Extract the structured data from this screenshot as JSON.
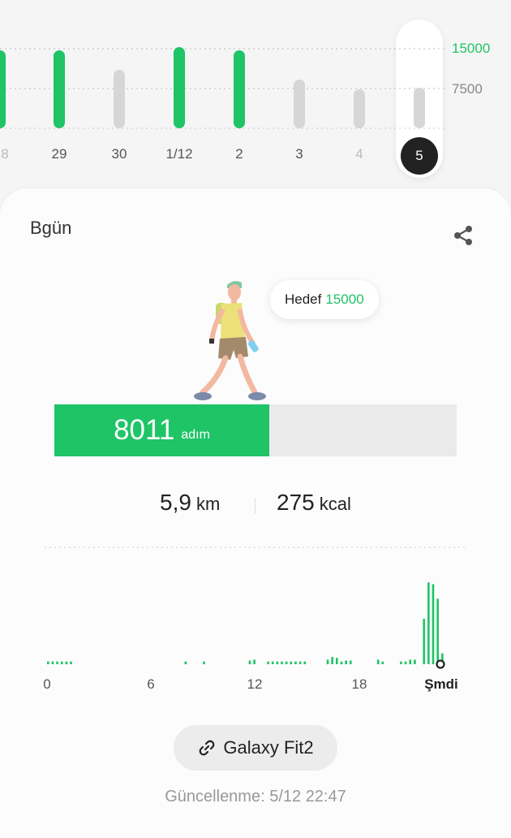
{
  "weekly_chart": {
    "reference_lines": [
      {
        "value": 15000,
        "label": "15000",
        "color": "#1fc466"
      },
      {
        "value": 7500,
        "label": "7500",
        "color": "#888888"
      }
    ],
    "days": [
      {
        "label": "8",
        "fraction": 0.96,
        "goal_met": true,
        "dim": true
      },
      {
        "label": "29",
        "fraction": 0.96,
        "goal_met": true,
        "dim": false
      },
      {
        "label": "30",
        "fraction": 0.72,
        "goal_met": false,
        "dim": false
      },
      {
        "label": "1/12",
        "fraction": 1.0,
        "goal_met": true,
        "dim": false
      },
      {
        "label": "2",
        "fraction": 0.96,
        "goal_met": true,
        "dim": false
      },
      {
        "label": "3",
        "fraction": 0.6,
        "goal_met": false,
        "dim": false
      },
      {
        "label": "4",
        "fraction": 0.48,
        "goal_met": false,
        "dim": true
      },
      {
        "label": "5",
        "fraction": 0.5,
        "goal_met": false,
        "dim": false,
        "selected": true
      }
    ]
  },
  "today": {
    "title": "Bgün",
    "share_icon": "share-icon",
    "goal_prefix": "Hedef",
    "goal_value": "15000",
    "steps_value": "8011",
    "steps_unit": "adım",
    "steps_progress": 0.534,
    "distance_value": "5,9",
    "distance_unit": "km",
    "calories_value": "275",
    "calories_unit": "kcal"
  },
  "hourly_chart": {
    "x_labels": [
      "0",
      "6",
      "12",
      "18",
      "Şmdi"
    ],
    "values": [
      0.03,
      0.03,
      0.03,
      0.03,
      0.03,
      0.03,
      0,
      0,
      0,
      0,
      0,
      0,
      0,
      0,
      0,
      0,
      0,
      0,
      0,
      0,
      0,
      0,
      0,
      0,
      0,
      0,
      0,
      0,
      0,
      0,
      0.03,
      0,
      0,
      0,
      0.03,
      0,
      0,
      0,
      0,
      0,
      0,
      0,
      0,
      0,
      0.04,
      0.05,
      0,
      0,
      0.03,
      0.03,
      0.03,
      0.03,
      0.03,
      0.03,
      0.03,
      0.03,
      0.03,
      0,
      0,
      0,
      0,
      0.05,
      0.08,
      0.07,
      0.03,
      0.04,
      0.04,
      0,
      0,
      0,
      0,
      0,
      0.05,
      0.03,
      0,
      0,
      0,
      0.03,
      0.03,
      0.05,
      0.05,
      0,
      0.5,
      0.9,
      0.88,
      0.72,
      0.12
    ],
    "color": "#1fc466"
  },
  "device": {
    "icon": "link-icon",
    "name": "Galaxy Fit2"
  },
  "updated_text": "Güncellenme: 5/12 22:47"
}
